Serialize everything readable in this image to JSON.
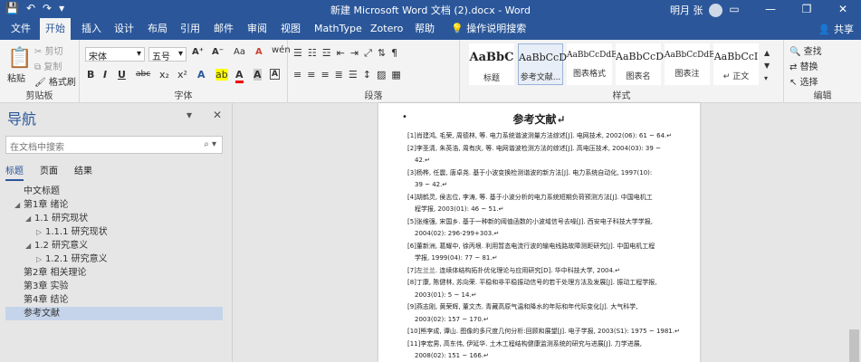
{
  "window": {
    "title": "新建 Microsoft Word 文档 (2).docx - Word",
    "user": "明月 张",
    "controls": [
      "▭",
      "—",
      "❐",
      "✕"
    ]
  },
  "qat": [
    "💾",
    "↶",
    "↷",
    "▾"
  ],
  "tabs": [
    "文件",
    "开始",
    "插入",
    "设计",
    "布局",
    "引用",
    "邮件",
    "审阅",
    "视图",
    "MathType",
    "Zotero",
    "帮助",
    "操作说明搜索"
  ],
  "share": "共享",
  "clipboard": {
    "paste": "粘贴",
    "cut": "剪切",
    "copy": "复制",
    "format_painter": "格式刷",
    "label": "剪贴板"
  },
  "font": {
    "name": "宋体",
    "size": "五号",
    "wen": "wén",
    "label": "字体",
    "grow": "A⁺",
    "shrink": "A⁻",
    "clear": "A",
    "bold": "B",
    "italic": "I",
    "underline": "U",
    "strike": "abc",
    "sub": "x₂",
    "sup": "x²",
    "highlight": "A",
    "color": "A",
    "aa": "Aa"
  },
  "paragraph": {
    "label": "段落"
  },
  "styles": {
    "label": "样式",
    "items": [
      {
        "preview": "AaBbC",
        "name": "标题"
      },
      {
        "preview": "AaBbCcDc",
        "name": "参考文献..."
      },
      {
        "preview": "AaBbCcDdE",
        "name": "图表格式"
      },
      {
        "preview": "AaBbCcDc",
        "name": "图表名"
      },
      {
        "preview": "AaBbCcDdE",
        "name": "图表注"
      },
      {
        "preview": "AaBbCcI",
        "name": "↵ 正文"
      }
    ]
  },
  "editing": {
    "find": "查找",
    "replace": "替换",
    "select": "选择",
    "label": "编辑"
  },
  "nav": {
    "title": "导航",
    "search_placeholder": "在文档中搜索",
    "tabs": [
      "标题",
      "页面",
      "结果"
    ],
    "tree": [
      {
        "t": "中文标题",
        "l": 0,
        "tri": ""
      },
      {
        "t": "第1章 绪论",
        "l": 0,
        "tri": "◢"
      },
      {
        "t": "1.1 研究现状",
        "l": 1,
        "tri": "◢"
      },
      {
        "t": "1.1.1 研究现状",
        "l": 2,
        "tri": "▷"
      },
      {
        "t": "1.2 研究意义",
        "l": 1,
        "tri": "◢"
      },
      {
        "t": "1.2.1 研究意义",
        "l": 2,
        "tri": "▷"
      },
      {
        "t": "第2章 相关理论",
        "l": 0,
        "tri": ""
      },
      {
        "t": "第3章 实验",
        "l": 0,
        "tri": ""
      },
      {
        "t": "第4章 结论",
        "l": 0,
        "tri": ""
      },
      {
        "t": "参考文献",
        "l": 0,
        "tri": "",
        "sel": true
      }
    ]
  },
  "document": {
    "heading": "参考文献↵",
    "refs": [
      {
        "a": "[1]肖建鸿, 毛荣, 周德林, 等. 电力系统谐波测量方法综述[J]. 电网技术, 2002(06): 61 ~ 64.↵",
        "b": ""
      },
      {
        "a": "[2]李圣清, 朱英浩, 周有庆, 等. 电网谐波检测方法的综述[J]. 高电压技术, 2004(03): 39 ~",
        "b": "42.↵"
      },
      {
        "a": "[3]杨桦, 任震, 唐卓尧. 基于小波变换检测谐波的新方法[J]. 电力系统自动化, 1997(10):",
        "b": "39 ~ 42.↵"
      },
      {
        "a": "[4]胡鹤灵, 侯志位, 李涛, 等. 基于小波分析的电力系统短期负荷预测方法[J]. 中国电机工",
        "b": "程学报, 2003(01): 46 ~ 51.↵"
      },
      {
        "a": "[5]张维强, 宋国乡. 基于一种新的阈值函数的小波域信号去噪[J]. 西安电子科技大学学报,",
        "b": "2004(02): 296-299+303.↵"
      },
      {
        "a": "[6]董新洲, 葛耀中, 徐丙垠. 利用暂态电流行波的输电线路故障测距研究[J]. 中国电机工程",
        "b": "学报, 1999(04): 77 ~ 81.↵"
      },
      {
        "a": "[7]左兰兰. 连续体结构拓扑优化理论与应用研究[D]. 华中科技大学, 2004.↵",
        "b": ""
      },
      {
        "a": "[8]丁康, 陈健林, 苏向荣. 平稳和非平稳振动信号的若干处理方法及发展[J]. 振动工程学报,",
        "b": "2003(01): 5 ~ 14.↵"
      },
      {
        "a": "[9]燕志刚, 黄荣辉, 董文杰. 青藏高原气温和降水的年际和年代际变化[J]. 大气科学,",
        "b": "2003(02): 157 ~ 170.↵"
      },
      {
        "a": "[10]熊李成, 谭山. 图像的多尺度几何分析:回顾和展望[J]. 电子学报, 2003(S1): 1975 ~ 1981.↵",
        "b": ""
      },
      {
        "a": "[11]李宏男, 高东伟, 伊延华. 土木工程结构健康监测系统的研究与进展[J]. 力学进展,",
        "b": "2008(02): 151 ~ 166.↵"
      }
    ]
  }
}
